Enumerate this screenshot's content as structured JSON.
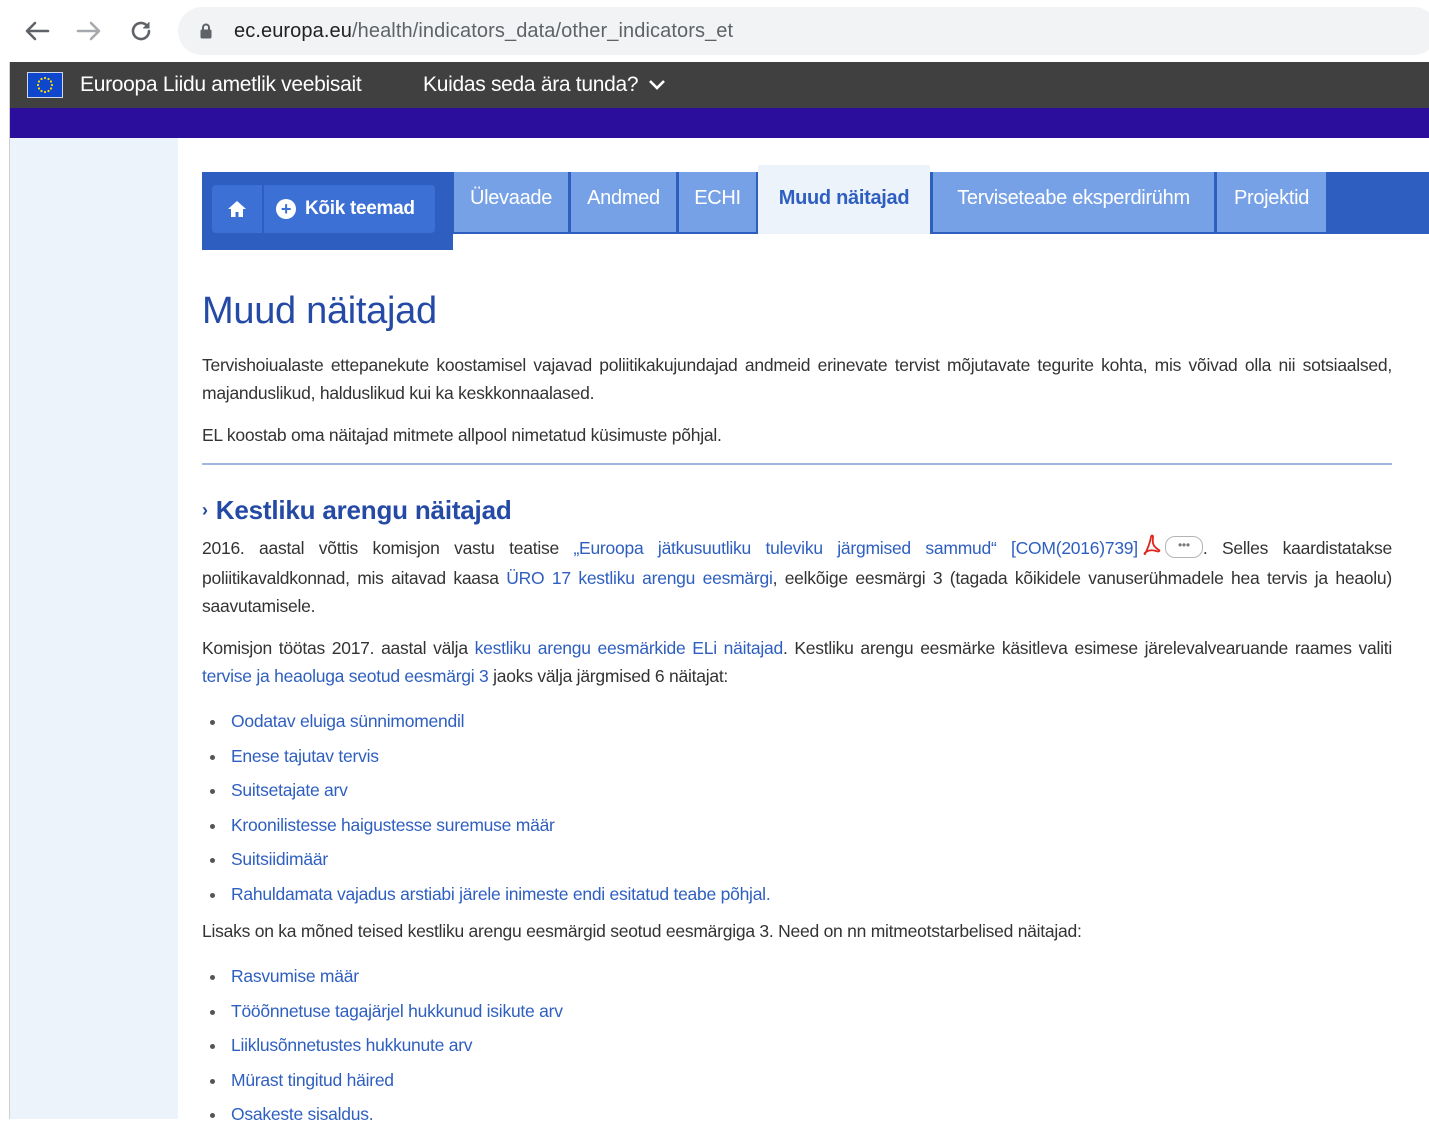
{
  "browser": {
    "url_domain": "ec.europa.eu",
    "url_path": "/health/indicators_data/other_indicators_et"
  },
  "eu_bar": {
    "title": "Euroopa Liidu ametlik veebisait",
    "how_to_recognise": "Kuidas seda ära tunda?"
  },
  "nav": {
    "all_topics": "Kõik teemad",
    "tabs": [
      {
        "label": "Ülevaade",
        "active": false
      },
      {
        "label": "Andmed",
        "active": false
      },
      {
        "label": "ECHI",
        "active": false
      },
      {
        "label": "Muud näitajad",
        "active": true
      },
      {
        "label": "Terviseteabe eksperdirühm",
        "active": false
      },
      {
        "label": "Projektid",
        "active": false
      }
    ]
  },
  "page": {
    "title": "Muud näitajad",
    "intro_1": "Tervishoiualaste ettepanekute koostamisel vajavad poliitikakujundajad andmeid erinevate tervist mõjutavate tegurite kohta, mis võivad olla nii sotsiaalsed, majanduslikud, halduslikud kui ka keskkonnaalased.",
    "intro_2": "EL koostab oma näitajad mitmete allpool nimetatud küsimuste põhjal."
  },
  "section": {
    "title": "Kestliku arengu näitajad",
    "p1": {
      "t1": "2016. aastal võttis komisjon vastu teatise ",
      "link1": "„Euroopa jätkusuutliku tuleviku järgmised sammud“ [COM(2016)739]",
      "t2": ". Selles kaardistatakse poliitikavaldkonnad, mis aitavad kaasa ",
      "link2": "ÜRO 17 kestliku arengu eesmärgi",
      "t3": ", eelkõige eesmärgi 3 (tagada kõikidele vanuserühmadele hea tervis ja heaolu) saavutamisele."
    },
    "p2": {
      "t1": "Komisjon töötas 2017. aastal välja ",
      "link1": "kestliku arengu eesmärkide ELi näitajad",
      "t2": ". Kestliku arengu eesmärke käsitleva esimese järelevalvearuande raames valiti ",
      "link2": "tervise ja heaoluga seotud eesmärgi 3",
      "t3": " jaoks välja järgmised 6 näitajat:"
    },
    "list1": [
      "Oodatav eluiga sünnimomendil",
      "Enese tajutav tervis",
      "Suitsetajate arv",
      "Kroonilistesse haigustesse suremuse määr",
      "Suitsiidimäär",
      "Rahuldamata vajadus arstiabi järele inimeste endi esitatud teabe põhjal."
    ],
    "p3": "Lisaks on ka mõned teised kestliku arengu eesmärgid seotud eesmärgiga 3. Need on nn mitmeotstarbelised näitajad:",
    "list2": [
      "Rasvumise määr",
      "Tööõnnetuse tagajärjel hukkunud isikute arv",
      "Liiklusõnnetustes hukkunute arv",
      "Mürast tingitud häired",
      "Osakeste sisaldus."
    ]
  },
  "colors": {
    "eu_bar": "#404040",
    "purple_bar": "#2b0e9b",
    "nav_blue": "#2e5fc0",
    "tab_light": "#76a1e6",
    "link": "#2e5fc0",
    "title": "#254aa5"
  }
}
